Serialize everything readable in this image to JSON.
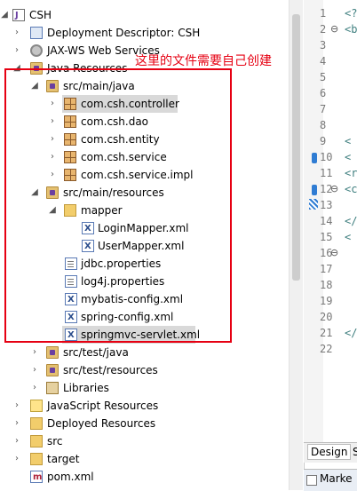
{
  "annotation": "这里的文件需要自己创建",
  "tree": {
    "root": "CSH",
    "items": [
      {
        "label": "Deployment Descriptor: CSH"
      },
      {
        "label": "JAX-WS Web Services"
      },
      {
        "label": "Java Resources"
      },
      {
        "label": "src/main/java"
      },
      {
        "label": "com.csh.controller"
      },
      {
        "label": "com.csh.dao"
      },
      {
        "label": "com.csh.entity"
      },
      {
        "label": "com.csh.service"
      },
      {
        "label": "com.csh.service.impl"
      },
      {
        "label": "src/main/resources"
      },
      {
        "label": "mapper"
      },
      {
        "label": "LoginMapper.xml"
      },
      {
        "label": "UserMapper.xml"
      },
      {
        "label": "jdbc.properties"
      },
      {
        "label": "log4j.properties"
      },
      {
        "label": "mybatis-config.xml"
      },
      {
        "label": "spring-config.xml"
      },
      {
        "label": "springmvc-servlet.xml"
      },
      {
        "label": "src/test/java"
      },
      {
        "label": "src/test/resources"
      },
      {
        "label": "Libraries"
      },
      {
        "label": "JavaScript Resources"
      },
      {
        "label": "Deployed Resources"
      },
      {
        "label": "src"
      },
      {
        "label": "target"
      },
      {
        "label": "pom.xml"
      }
    ]
  },
  "editor": {
    "line_numbers": [
      "1",
      "2",
      "3",
      "4",
      "5",
      "6",
      "7",
      "8",
      "9",
      "10",
      "11",
      "12",
      "13",
      "14",
      "15",
      "16",
      "17",
      "18",
      "19",
      "20",
      "21",
      "22"
    ],
    "snippets": [
      "<?",
      "<b",
      "<",
      "<",
      "<r",
      "<c",
      "</",
      "<",
      "</"
    ],
    "tab_design": "Design",
    "tab_source": "S",
    "bottom_tab": "Marke"
  }
}
